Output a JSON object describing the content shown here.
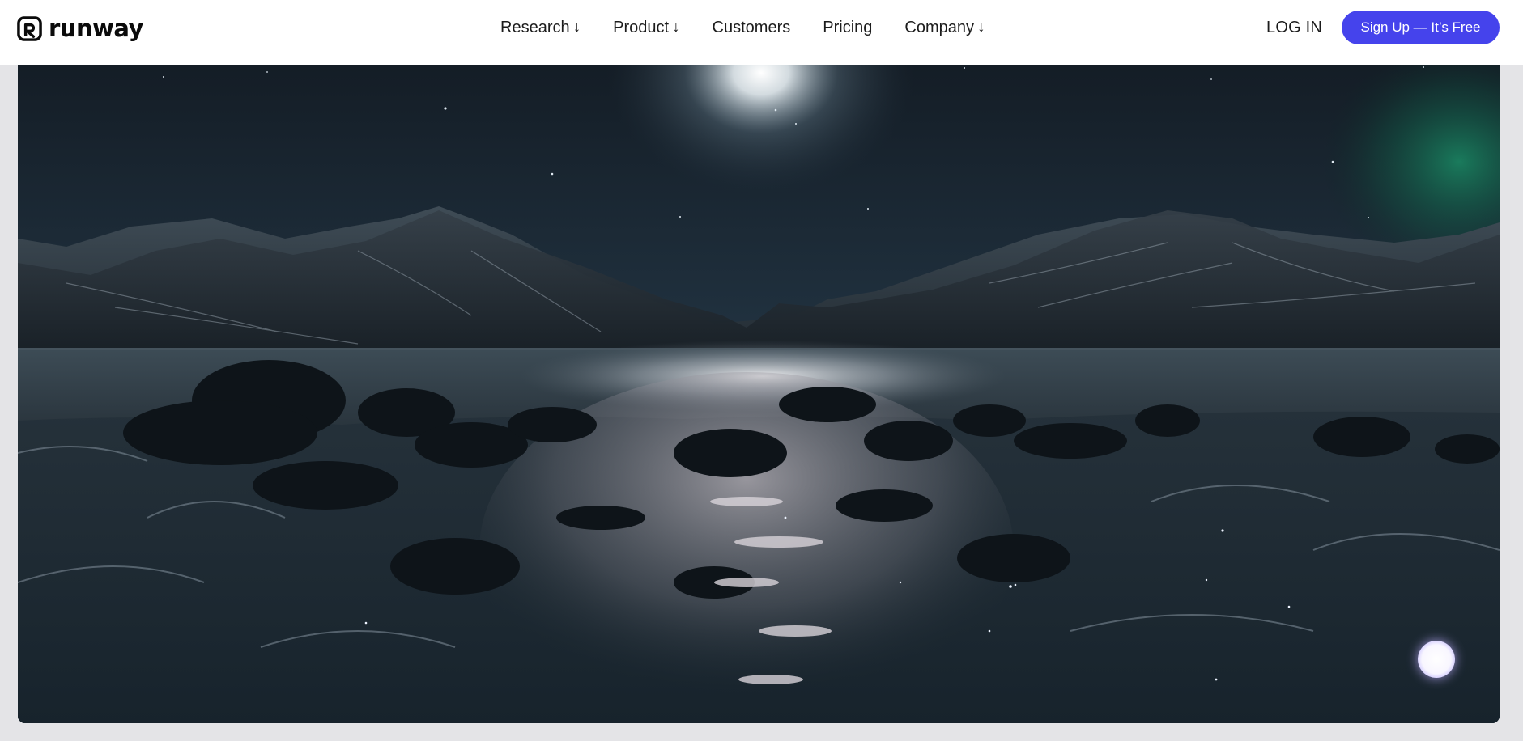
{
  "brand": {
    "name": "runway",
    "icon": "runway-logo-icon"
  },
  "nav": {
    "items": [
      {
        "label": "Research",
        "has_dropdown": true,
        "arrow": "↓"
      },
      {
        "label": "Product",
        "has_dropdown": true,
        "arrow": "↓"
      },
      {
        "label": "Customers",
        "has_dropdown": false
      },
      {
        "label": "Pricing",
        "has_dropdown": false
      },
      {
        "label": "Company",
        "has_dropdown": true,
        "arrow": "↓"
      }
    ],
    "login_label": "LOG IN",
    "signup_label": "Sign Up — It’s Free"
  },
  "hero": {
    "media": "night landscape video: moonlit mountains, lake and snowy rocky shore",
    "icons": [
      "moon-glow",
      "aurora-glow",
      "stars"
    ]
  },
  "chat_widget": {
    "icon": "chat-bubble-icon"
  },
  "colors": {
    "accent": "#4543ec",
    "nav_background": "#ffffff",
    "page_background": "#e4e4e7",
    "text": "#1c1c1c"
  }
}
